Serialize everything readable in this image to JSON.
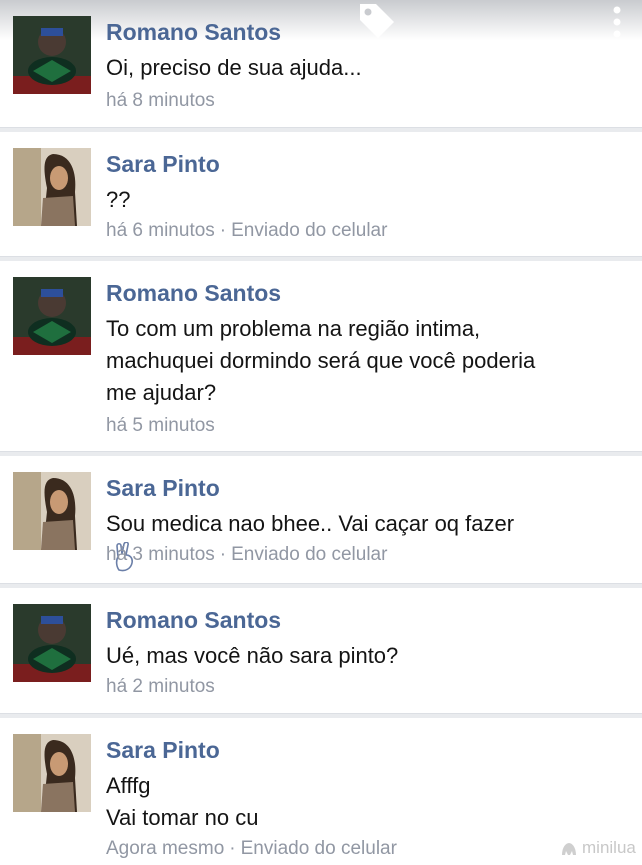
{
  "messages": [
    {
      "sender": "Romano Santos",
      "lines": [
        "Oi, preciso de sua ajuda..."
      ],
      "time": "há 8 minutos",
      "via": "",
      "avatar": "romano-avatar"
    },
    {
      "sender": "Sara Pinto",
      "lines": [
        "??"
      ],
      "time": "há 6 minutos",
      "via": "Enviado do celular",
      "avatar": "sara-avatar"
    },
    {
      "sender": "Romano Santos",
      "lines": [
        "To com um problema na região intima,",
        "machuquei dormindo será que você poderia",
        "me ajudar?"
      ],
      "time": "há 5 minutos",
      "via": "",
      "avatar": "romano-avatar"
    },
    {
      "sender": "Sara Pinto",
      "lines": [
        "Sou medica nao bhee.. Vai caçar oq fazer"
      ],
      "time": "há 3 minutos",
      "via": "Enviado do celular",
      "avatar": "sara-avatar"
    },
    {
      "sender": "Romano Santos",
      "lines": [
        "Ué, mas você não sara pinto?"
      ],
      "time": "há 2 minutos",
      "via": "",
      "avatar": "romano-avatar"
    },
    {
      "sender": "Sara Pinto",
      "lines": [
        "Afffg",
        "Vai tomar no cu"
      ],
      "time": "Agora mesmo",
      "via": "Enviado do celular",
      "avatar": "sara-avatar"
    }
  ],
  "separator": "·",
  "watermark": "minilua",
  "icons": {
    "tag": "tag-icon",
    "more": "more-vertical-icon",
    "wave": "peace-hand-emoji"
  },
  "colors": {
    "sender": "#4b6795",
    "meta": "#9197a3",
    "text": "#141414",
    "background": "#e9ebee"
  }
}
